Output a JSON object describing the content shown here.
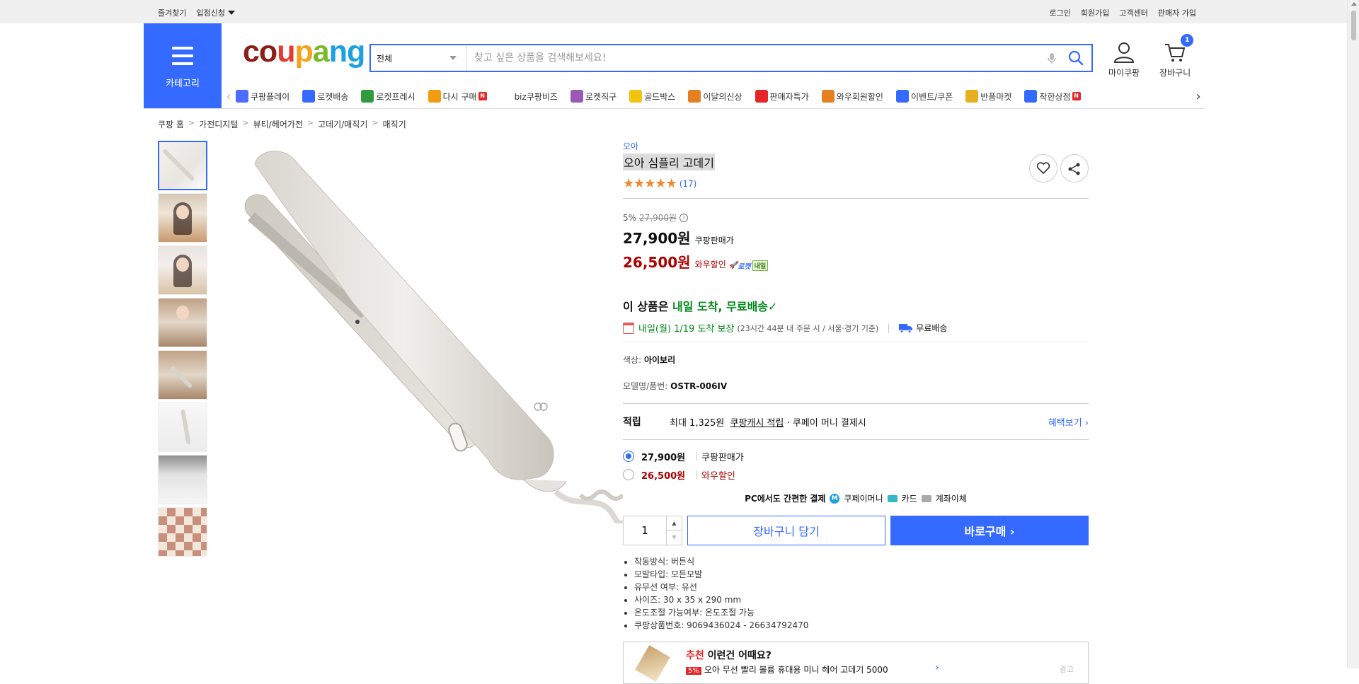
{
  "topbar": {
    "left": [
      "즐겨찾기",
      "입점신청"
    ],
    "right": [
      "로그인",
      "회원가입",
      "고객센터",
      "판매자 가입"
    ]
  },
  "header": {
    "category_label": "카테고리",
    "logo_letters": [
      "c",
      "o",
      "u",
      "p",
      "a",
      "n",
      "g"
    ],
    "search_scope": "전체",
    "search_placeholder": "찾고 싶은 상품을 검색해보세요!",
    "mypage_label": "마이쿠팡",
    "cart_label": "장바구니",
    "cart_count": "1"
  },
  "subnav": [
    {
      "label": "쿠팡플레이",
      "color": "#4c6bff"
    },
    {
      "label": "로켓배송",
      "color": "#346aff"
    },
    {
      "label": "로켓프레시",
      "color": "#2e9b3c"
    },
    {
      "label": "다시 구매",
      "color": "#f39c12",
      "new": "N"
    },
    {
      "label": "biz쿠팡비즈",
      "color": "#ffffff"
    },
    {
      "label": "로켓직구",
      "color": "#9b59b6"
    },
    {
      "label": "골드박스",
      "color": "#f1c40f"
    },
    {
      "label": "이달의신상",
      "color": "#e67e22"
    },
    {
      "label": "판매자특가",
      "color": "#e52528"
    },
    {
      "label": "와우회원할인",
      "color": "#e67e22"
    },
    {
      "label": "이벤트/쿠폰",
      "color": "#346aff"
    },
    {
      "label": "반품마켓",
      "color": "#e6b022"
    },
    {
      "label": "착한상점",
      "color": "#346aff",
      "new": "N"
    }
  ],
  "breadcrumb": [
    "쿠팡 홈",
    "가전디지털",
    "뷰티/헤어가전",
    "고데기/매직기",
    "매직기"
  ],
  "product": {
    "brand": "오아",
    "name": "오아 심플리 고데기",
    "stars": "★★★★★",
    "review_count": "(17)",
    "discount_rate": "5%",
    "original_price": "27,900원",
    "info_icon": "i",
    "price": "27,900원",
    "price_label": "쿠팡판매가",
    "wow_price": "26,500원",
    "wow_label": "와우할인",
    "rocket_label": "로켓",
    "rocket_tomorrow": "내일",
    "arrival_prefix": "이 상품은 ",
    "arrival_highlight": "내일 도착, 무료배송",
    "arrival_check": "✓",
    "delivery_date": "내일(월) 1/19 도착 보장",
    "delivery_note": "(23시간 44분 내 주문 시 / 서울⋅경기 기준)",
    "free_shipping": "무료배송",
    "color_label": "색상:",
    "color_value": "아이보리",
    "model_label": "모델명/품번:",
    "model_value": "OSTR-006IV",
    "reward_heading": "적립",
    "reward_text": "최대 1,325원",
    "reward_link": "쿠팡캐시 적립",
    "reward_suffix": "· 쿠페이 머니 결제시",
    "reward_more": "혜택보기 ›",
    "options": [
      {
        "price": "27,900원",
        "label": "쿠팡판매가",
        "selected": true
      },
      {
        "price": "26,500원",
        "label": "와우할인",
        "selected": false
      }
    ],
    "pay_text": "PC에서도 간편한 결제",
    "pay_methods": [
      "쿠페이머니",
      "카드",
      "계좌이체"
    ],
    "pay_money_icon": "M",
    "quantity": "1",
    "qty_up": "▲",
    "qty_down": "▼",
    "cart_button": "장바구니 담기",
    "buy_button": "바로구매 ›",
    "specs": [
      "작동방식: 버튼식",
      "모발타입: 모든모발",
      "유무선 여부: 유선",
      "사이즈: 30 x 35 x 290 mm",
      "온도조절 가능여부: 온도조절 가능",
      "쿠팡상품번호: 9069436024 - 26634792470"
    ],
    "reco_tag": "추천",
    "reco_title": "이런건 어때요?",
    "reco_discount": "5%",
    "reco_item": "오아 무선 빨리 볼륨 휴대용 미니 헤어 고데기 5000",
    "reco_chevron": "›",
    "reco_ad": "광고"
  }
}
